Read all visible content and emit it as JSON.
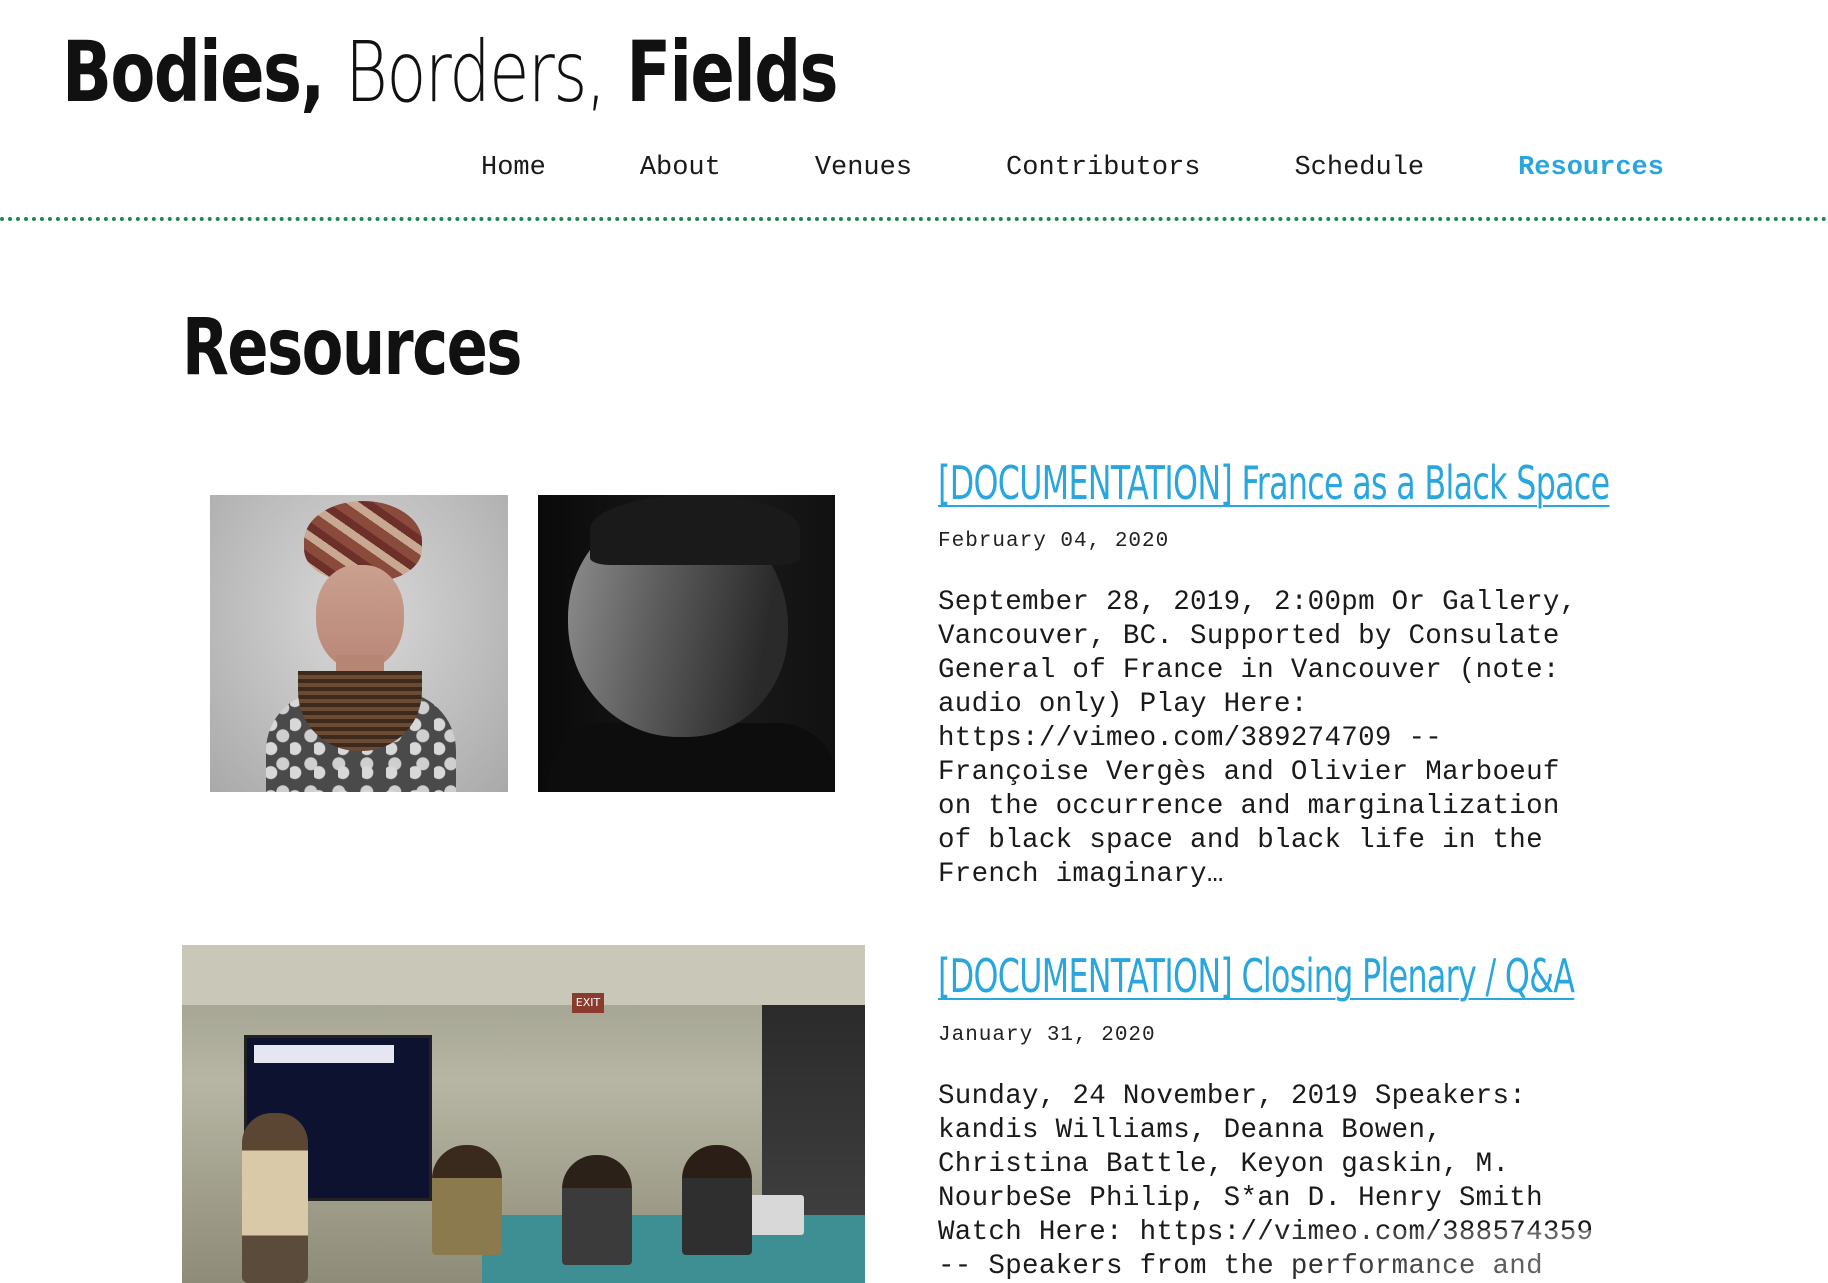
{
  "site": {
    "title_part1": "Bodies,",
    "title_part2": "Borders,",
    "title_part3": "Fields"
  },
  "nav": {
    "items": [
      {
        "label": "Home",
        "active": false
      },
      {
        "label": "About",
        "active": false
      },
      {
        "label": "Venues",
        "active": false
      },
      {
        "label": "Contributors",
        "active": false
      },
      {
        "label": "Schedule",
        "active": false
      },
      {
        "label": "Resources",
        "active": true
      }
    ]
  },
  "colors": {
    "accent": "#2aa6df",
    "rule": "#1f8a4c",
    "text": "#1a1a1a"
  },
  "page": {
    "title": "Resources"
  },
  "posts": [
    {
      "title": "[DOCUMENTATION] France as a Black Space",
      "date": "February 04, 2020",
      "excerpt": "September 28, 2019, 2:00pm Or Gallery,\nVancouver, BC. Supported by Consulate\nGeneral of France in Vancouver (note:\naudio only) Play Here:\nhttps://vimeo.com/389274709 --\nFrançoise Vergès and Olivier Marboeuf\non the occurrence and marginalization\nof black space and black life in the\nFrench imaginary…",
      "images": [
        "portrait-photo",
        "profile-portrait-photo"
      ]
    },
    {
      "title": "[DOCUMENTATION] Closing Plenary / Q&A",
      "date": "January 31, 2020",
      "excerpt": "Sunday, 24 November, 2019 Speakers:\nkandis Williams, Deanna Bowen,\nChristina Battle, Keyon gaskin, M.\nNourbeSe Philip, S*an D. Henry Smith\nWatch Here: https://vimeo.com/388574359\n-- Speakers from the performance and",
      "images": [
        "event-photo"
      ],
      "exit_sign": "EXIT"
    }
  ]
}
